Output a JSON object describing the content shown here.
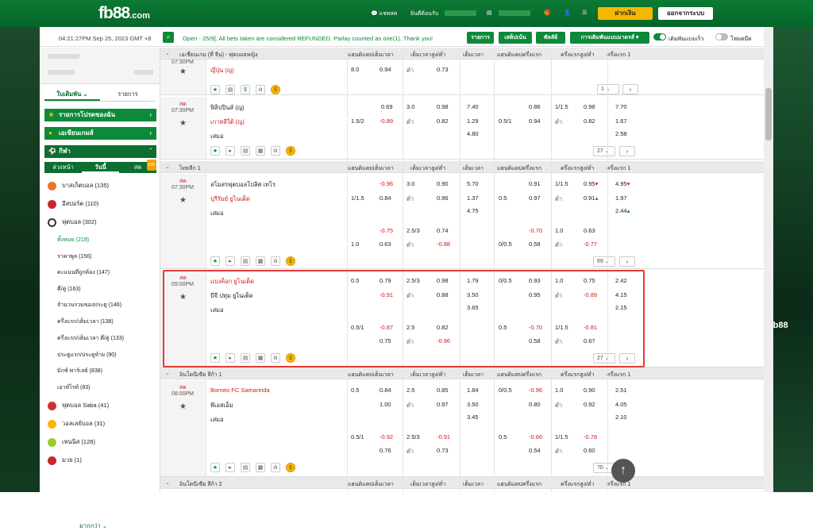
{
  "topbar": {
    "logo": "fb88",
    "logo_dom": ".com",
    "chat": "แชทสด",
    "welcome": "ยินดีต้อนรับ",
    "dep": "ฝากเงิน",
    "logout": "ออกจากระบบ"
  },
  "notice": {
    "time": "04:21:27PM Sep 25, 2023 GMT +8",
    "msg": "Open - 25/9]. All bets taken are considered REFUNDED. Parlay counted as one(1). Thank you!",
    "b1": "รายการ",
    "b2": "เสต็ปเน้น",
    "b3": "พัลลัย์",
    "b4": "การเดิมพันแบบมาตรส์",
    "t1": "เดิมพันแบบเร็ว",
    "t2": "โหมดมืด"
  },
  "sidebar": {
    "tab1": "ใบเดิมพัน",
    "tab2": "รายการ",
    "fav": "รายการโปรดของฉัน",
    "asia": "เอเชียนเกมส์",
    "sport": "กีฬา",
    "st1": "ล่วงหน้า",
    "st2": "วันนี้",
    "st3": "สด",
    "badge": "100",
    "sports": [
      {
        "n": "บาสเก็ตบอล",
        "c": "(135)",
        "col": "#e8762c"
      },
      {
        "n": "อีสปอร์ต",
        "c": "(110)",
        "col": "#c62828"
      },
      {
        "n": "ฟุตบอล",
        "c": "(302)",
        "col": "#333"
      }
    ],
    "subs": [
      {
        "n": "ทั้งหมด",
        "c": "(219)"
      },
      {
        "n": "ราคาพูล",
        "c": "(156)"
      },
      {
        "n": "คะแนนที่ถูกต้อง",
        "c": "(147)"
      },
      {
        "n": "คี่/คู่",
        "c": "(163)"
      },
      {
        "n": "จำนวนรวมของประตู",
        "c": "(146)"
      },
      {
        "n": "ครึ่งแรก/เต็มเวลา",
        "c": "(138)"
      },
      {
        "n": "ครึ่งแรก/เต็มเวลา คี่/คู่",
        "c": "(133)"
      },
      {
        "n": "ประตูแรก/ประตูท้าย",
        "c": "(90)"
      },
      {
        "n": "มิกซ์ พาร์เลย์",
        "c": "(838)"
      },
      {
        "n": "เอาท์ไรท์",
        "c": "(83)"
      }
    ],
    "sports2": [
      {
        "n": "ฟุตบอล Saba",
        "c": "(41)",
        "col": "#d32f2f"
      },
      {
        "n": "วอลเลย์บอล",
        "c": "(31)",
        "col": "#f5b800"
      },
      {
        "n": "เทนนิส",
        "c": "(128)",
        "col": "#9ccc2c"
      },
      {
        "n": "มวย",
        "c": "(1)",
        "col": "#c62828"
      }
    ],
    "more": "มากกว่า"
  },
  "cols": {
    "hdp": "แฮนดิแคปเต็มเวลา",
    "ou": "เต็มเวลาสูง/ต่ำ",
    "x": "เต็มเวลา",
    "h1": "แฮนดิแคปครึ่งแรก",
    "ou1": "ครึ่งแรกสูง/ต่ำ",
    "x1": "ครึ่งแรก 1"
  },
  "leagues": {
    "l1": "เอเชี่ยนเกม (ที่ จีน) - ฟุตบอลหญิง",
    "l2": "ไทยลีก 1",
    "l3": "อินโดนีเซีย ลีก้า 1",
    "l4": "อินโดนีเซีย ลีก้า 2"
  },
  "live": "สด",
  "draw": "เสมอ",
  "lo": "ต่ำ",
  "m0": {
    "time": "07:30PM",
    "t1": "ญี่ปุ่น (ญ)",
    "a": "8.0",
    "b": "0.94",
    "c": "ต่ำ",
    "d": "0.73",
    "cnt": "1"
  },
  "m1": {
    "time": "07:30PM",
    "t1": "ฟิลิปปินส์ (ญ)",
    "t2": "เกาหลีใต้ (ญ)",
    "r1": [
      "0.69",
      "3.0",
      "0.98",
      "7.40",
      "0.86",
      "1/1.5",
      "0.98",
      "7.70"
    ],
    "r2": [
      "1.5/2",
      "-0.89",
      "ต่ำ",
      "0.82",
      "1.29",
      "0.5/1",
      "0.94",
      "ต่ำ",
      "0.82",
      "1.67"
    ],
    "r3": [
      "4.80",
      "2.58"
    ],
    "cnt": "27"
  },
  "m2": {
    "time": "07:30PM",
    "t1": "สโมสรฟุตบอลโปลิศ เทโร",
    "t2": "บุรีรัมย์ ยูไนเต็ด",
    "r1": [
      "-0.96",
      "3.0",
      "0.90",
      "5.70",
      "0.91",
      "1/1.5",
      "0.95",
      "4.95"
    ],
    "r2": [
      "1/1.5",
      "0.84",
      "ต่ำ",
      "0.96",
      "1.37",
      "0.5",
      "0.97",
      "ต่ำ",
      "0.91",
      "1.97"
    ],
    "r3": [
      "4.75",
      "2.44"
    ],
    "r4": [
      "-0.75",
      "2.5/3",
      "0.74",
      "-0.70",
      "1.0",
      "0.63"
    ],
    "r5": [
      "1.0",
      "0.63",
      "ต่ำ",
      "-0.88",
      "0/0.5",
      "0.58",
      "ต่ำ",
      "-0.77"
    ],
    "cnt": "69"
  },
  "m3": {
    "time": "09:00PM",
    "t1": "แบงค็อก ยูไนเต็ด",
    "t2": "บีจี ปทุม ยูไนเต็ด",
    "r1": [
      "0.5",
      "0.79",
      "2.5/3",
      "0.98",
      "1.79",
      "0/0.5",
      "0.93",
      "1.0",
      "0.75",
      "2.42"
    ],
    "r2": [
      "-0.91",
      "ต่ำ",
      "0.88",
      "3.50",
      "0.95",
      "ต่ำ",
      "-0.89",
      "4.15"
    ],
    "r3": [
      "3.65",
      "2.15"
    ],
    "r4": [
      "0.5/1",
      "-0.87",
      "2.5",
      "0.82",
      "0.5",
      "-0.70",
      "1/1.5",
      "-0.81"
    ],
    "r5": [
      "0.75",
      "ต่ำ",
      "-0.96",
      "0.58",
      "ต่ำ",
      "0.67"
    ],
    "cnt": "27"
  },
  "m4": {
    "time": "08:00PM",
    "t1": "Borneo FC Samarinda",
    "t2": "พีเอสเอ็ม",
    "r1": [
      "0.5",
      "0.84",
      "2.5",
      "0.85",
      "1.84",
      "0/0.5",
      "-0.96",
      "1.0",
      "0.90",
      "2.51"
    ],
    "r2": [
      "1.00",
      "ต่ำ",
      "0.97",
      "3.50",
      "0.80",
      "ต่ำ",
      "0.92",
      "4.05"
    ],
    "r3": [
      "3.45",
      "2.10"
    ],
    "r4": [
      "0.5/1",
      "-0.92",
      "2.5/3",
      "-0.91",
      "0.5",
      "-0.66",
      "1/1.5",
      "-0.78"
    ],
    "r5": [
      "0.76",
      "ต่ำ",
      "0.73",
      "0.54",
      "ต่ำ",
      "0.60"
    ],
    "cnt": "70"
  }
}
